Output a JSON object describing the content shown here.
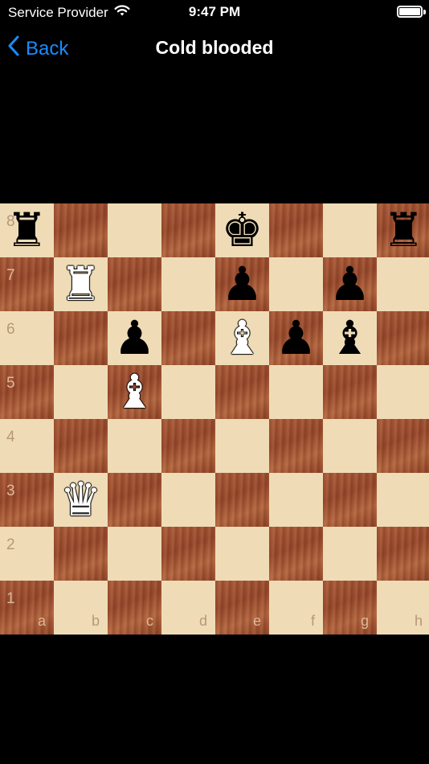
{
  "status": {
    "carrier": "Service Provider",
    "time": "9:47 PM",
    "battery_level": 1.0,
    "icons": [
      "wifi-icon",
      "battery-icon"
    ]
  },
  "nav": {
    "back_label": "Back",
    "title": "Cold blooded",
    "accent_color": "#1a8cff"
  },
  "board": {
    "files": [
      "a",
      "b",
      "c",
      "d",
      "e",
      "f",
      "g",
      "h"
    ],
    "ranks": [
      "8",
      "7",
      "6",
      "5",
      "4",
      "3",
      "2",
      "1"
    ],
    "pieces": [
      {
        "square": "a8",
        "color": "black",
        "type": "rook",
        "glyph": "♜"
      },
      {
        "square": "e8",
        "color": "black",
        "type": "king",
        "glyph": "♚"
      },
      {
        "square": "h8",
        "color": "black",
        "type": "rook",
        "glyph": "♜"
      },
      {
        "square": "b7",
        "color": "white",
        "type": "rook",
        "glyph": "♜"
      },
      {
        "square": "e7",
        "color": "black",
        "type": "pawn",
        "glyph": "♟"
      },
      {
        "square": "g7",
        "color": "black",
        "type": "pawn",
        "glyph": "♟"
      },
      {
        "square": "c6",
        "color": "black",
        "type": "pawn",
        "glyph": "♟"
      },
      {
        "square": "e6",
        "color": "white",
        "type": "bishop",
        "glyph": "♝"
      },
      {
        "square": "f6",
        "color": "black",
        "type": "pawn",
        "glyph": "♟"
      },
      {
        "square": "g6",
        "color": "black",
        "type": "bishop",
        "glyph": "♝"
      },
      {
        "square": "c5",
        "color": "white",
        "type": "bishop",
        "glyph": "♝"
      },
      {
        "square": "b3",
        "color": "white",
        "type": "queen",
        "glyph": "♛"
      }
    ]
  }
}
